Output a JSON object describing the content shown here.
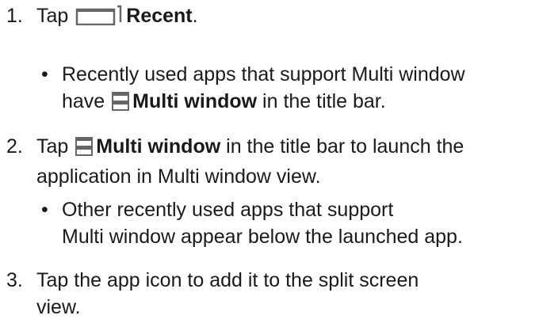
{
  "steps": [
    {
      "number": "1.",
      "pre": "Tap",
      "icon": "recent-apps-icon",
      "bold": "Recent",
      "post": "."
    },
    {
      "number": "2.",
      "pre": "Tap",
      "icon": "multi-window-icon",
      "bold": "Multi window",
      "post_line1": " in the title bar to launch the",
      "post_line2": "application in Multi window view."
    },
    {
      "number": "3.",
      "line1": "Tap the app icon to add it to the split screen",
      "line2": "view."
    }
  ],
  "bullets": [
    {
      "line1": "Recently used apps that support Multi window",
      "pre2": "have",
      "icon": "multi-window-icon",
      "bold": "Multi window",
      "post2": " in the title bar."
    },
    {
      "line1": "Other recently used apps that support",
      "line2": "Multi window appear below the launched app."
    }
  ],
  "colors": {
    "text": "#1a1a1a",
    "icon": "#666666"
  }
}
